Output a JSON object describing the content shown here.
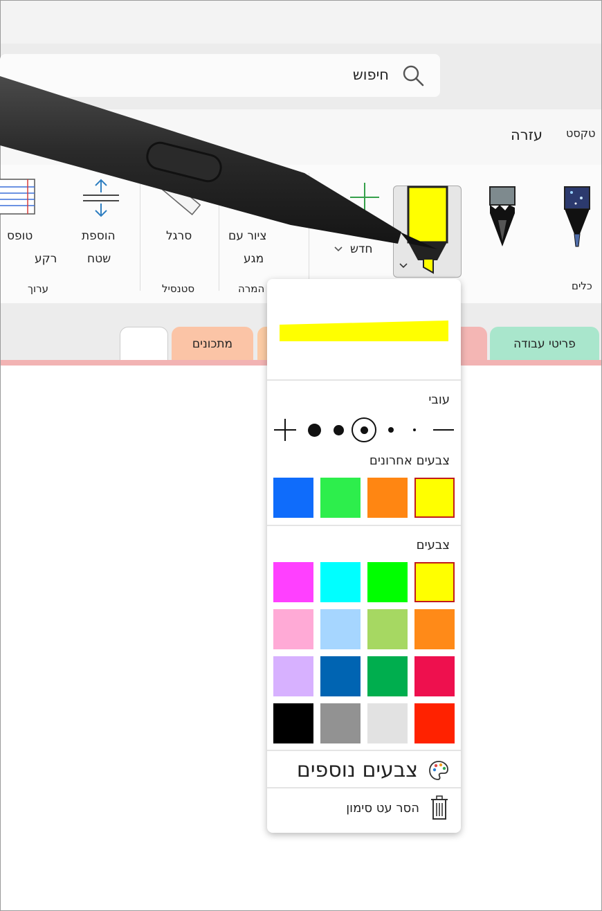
{
  "search": {
    "label": "חיפוש"
  },
  "menu": {
    "help": "עזרה",
    "context": "טקסט"
  },
  "ribbon": {
    "tools_group": "כלים",
    "new_label": "חדש",
    "draw_touch_line1": "ציור עם",
    "draw_touch_line2": "מגע",
    "ruler_label": "סרגל",
    "add_space_line1": "הוספת",
    "add_space_line2": "שטח",
    "paper_line1": "טופס",
    "paper_line2": "רקע",
    "group_convert": "המרה",
    "group_stencil": "סטנסיל",
    "group_edit": "ערוך"
  },
  "tabs": [
    {
      "label": "פריטי עבודה",
      "color": "#a9e6cc"
    },
    {
      "label": "",
      "color": "#f4b6b4"
    },
    {
      "label": "",
      "color": "#fbcba4"
    },
    {
      "label": "מתכונים",
      "color": "#fbc4a6"
    },
    {
      "label": "",
      "color": "#ffffff"
    }
  ],
  "pen_popup": {
    "preview_color": "#ffff00",
    "thickness_title": "עובי",
    "recent_title": "צבעים אחרונים",
    "recent_colors": [
      "#ffff00",
      "#ff8612",
      "#2dee4c",
      "#0f6cfb"
    ],
    "colors_title": "צבעים",
    "colors": [
      [
        "#ffff00",
        "#00ff00",
        "#00ffff",
        "#ff40ff"
      ],
      [
        "#ff8a18",
        "#a6d862",
        "#a6d6ff",
        "#ffaad6"
      ],
      [
        "#ee104e",
        "#00ae4e",
        "#0064b2",
        "#d7b1ff"
      ],
      [
        "#ff2200",
        "#e2e2e2",
        "#929292",
        "#000000"
      ]
    ],
    "selected_color": "#ffff00",
    "more_colors": "צבעים נוספים",
    "remove_pen": "הסר עט סימון"
  },
  "icons": {
    "search": "search-icon",
    "palette": "palette-icon",
    "trash": "trash-icon",
    "chevron": "chevron-down-icon"
  }
}
